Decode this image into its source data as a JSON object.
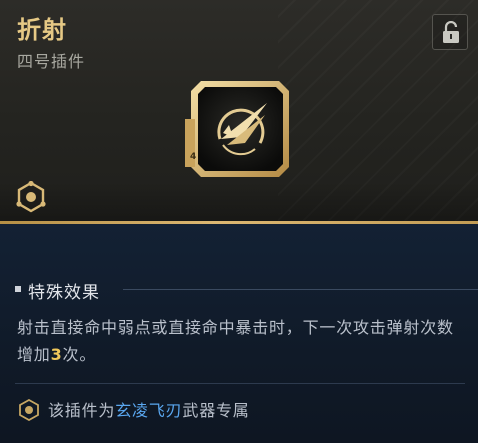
{
  "header": {
    "title": "折射",
    "subtitle": "四号插件",
    "lock_icon": "unlock-icon",
    "plugin_icon": "refract-plugin-icon",
    "category_icon": "hex-plugin-icon",
    "plugin_slot_label": "4"
  },
  "effect": {
    "heading": "特殊效果",
    "desc_before": "射击直接命中弱点或直接命中暴击时，下一次攻击弹射次数增加",
    "desc_value": "3",
    "desc_after": "次。"
  },
  "exclusive": {
    "prefix": "该插件为",
    "weapon": "玄凌飞刃",
    "suffix": "武器专属",
    "icon": "exclusive-icon"
  },
  "colors": {
    "gold": "#e6c985",
    "highlight": "#f0c75a",
    "weapon_link": "#5aa7f0",
    "panel_dark": "#101a28"
  }
}
